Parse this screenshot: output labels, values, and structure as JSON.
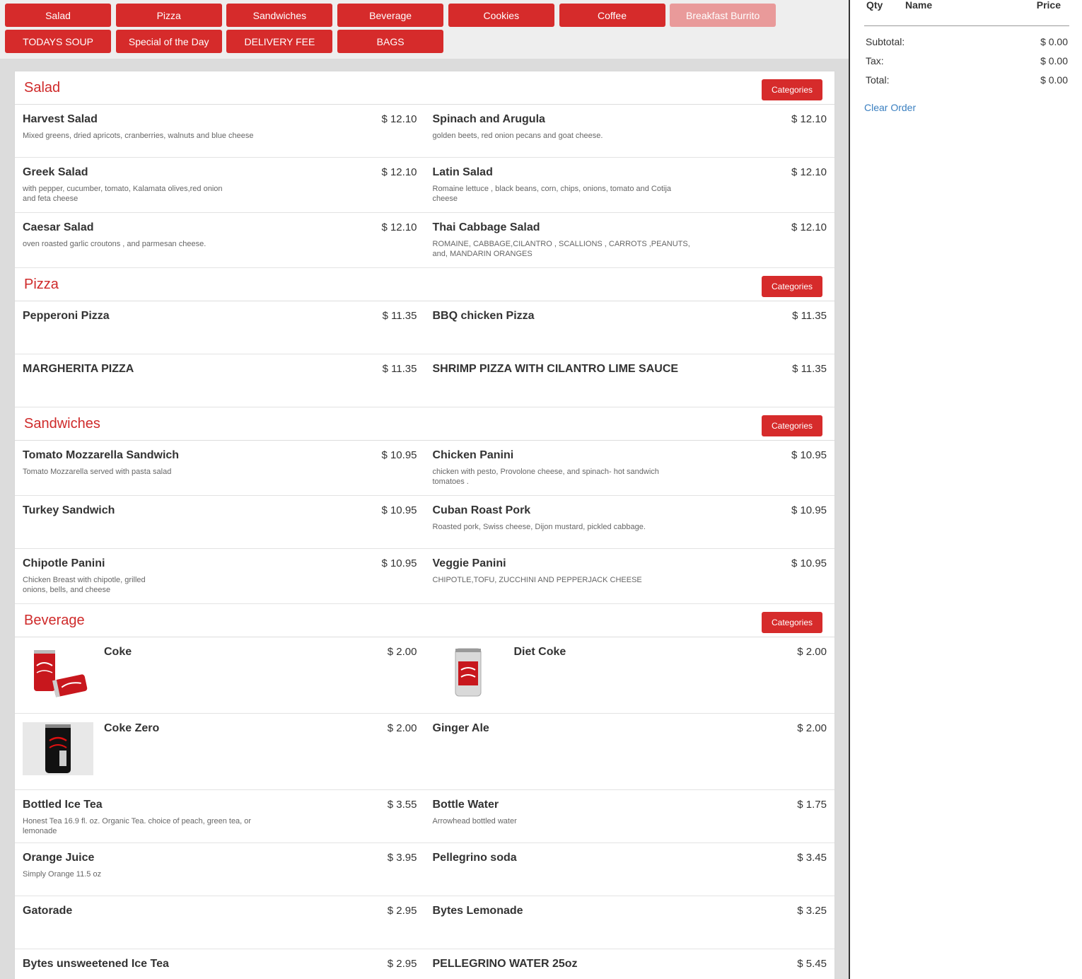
{
  "categories": [
    {
      "label": "Salad",
      "disabled": false
    },
    {
      "label": "Pizza",
      "disabled": false
    },
    {
      "label": "Sandwiches",
      "disabled": false
    },
    {
      "label": "Beverage",
      "disabled": false
    },
    {
      "label": "Cookies",
      "disabled": false
    },
    {
      "label": "Coffee",
      "disabled": false
    },
    {
      "label": "Breakfast Burrito",
      "disabled": true
    },
    {
      "label": "TODAYS SOUP",
      "disabled": false
    },
    {
      "label": "Special of the Day",
      "disabled": false
    },
    {
      "label": "DELIVERY FEE",
      "disabled": false
    },
    {
      "label": "BAGS",
      "disabled": false
    }
  ],
  "sections": [
    {
      "title": "Salad",
      "button": "Categories",
      "rows": [
        [
          {
            "name": "Harvest Salad",
            "price": "$ 12.10",
            "desc": "Mixed greens, dried apricots, cranberries, walnuts and blue cheese"
          },
          {
            "name": "Spinach and Arugula",
            "price": "$ 12.10",
            "desc": "golden beets, red onion pecans and goat cheese."
          }
        ],
        [
          {
            "name": "Greek Salad",
            "price": "$ 12.10",
            "desc": "with pepper, cucumber, tomato, Kalamata olives,red onion and feta cheese"
          },
          {
            "name": "Latin Salad",
            "price": "$ 12.10",
            "desc": "Romaine lettuce , black beans, corn, chips, onions, tomato and Cotija cheese"
          }
        ],
        [
          {
            "name": "Caesar Salad",
            "price": "$ 12.10",
            "desc": "oven roasted garlic croutons , and parmesan cheese."
          },
          {
            "name": "Thai Cabbage Salad",
            "price": "$ 12.10",
            "desc": "ROMAINE, CABBAGE,CILANTRO , SCALLIONS , CARROTS ,PEANUTS, and, MANDARIN ORANGES"
          }
        ]
      ]
    },
    {
      "title": "Pizza",
      "button": "Categories",
      "rows": [
        [
          {
            "name": "Pepperoni Pizza",
            "price": "$ 11.35",
            "desc": ""
          },
          {
            "name": "BBQ chicken Pizza",
            "price": "$ 11.35",
            "desc": ""
          }
        ],
        [
          {
            "name": "MARGHERITA PIZZA",
            "price": "$ 11.35",
            "desc": ""
          },
          {
            "name": "SHRIMP PIZZA WITH CILANTRO LIME SAUCE",
            "price": "$ 11.35",
            "desc": ""
          }
        ]
      ]
    },
    {
      "title": "Sandwiches",
      "button": "Categories",
      "rows": [
        [
          {
            "name": "Tomato Mozzarella Sandwich",
            "price": "$ 10.95",
            "desc": "Tomato Mozzarella served with pasta salad"
          },
          {
            "name": "Chicken Panini",
            "price": "$ 10.95",
            "desc": "chicken with pesto, Provolone cheese, and spinach- hot sandwich tomatoes ."
          }
        ],
        [
          {
            "name": "Turkey Sandwich",
            "price": "$ 10.95",
            "desc": ""
          },
          {
            "name": "Cuban Roast Pork",
            "price": "$ 10.95",
            "desc": "Roasted pork, Swiss cheese, Dijon mustard, pickled cabbage."
          }
        ],
        [
          {
            "name": "Chipotle Panini",
            "price": "$ 10.95",
            "desc": "Chicken Breast with chipotle, grilled onions, bells, and cheese"
          },
          {
            "name": "Veggie Panini",
            "price": "$ 10.95",
            "desc": "CHIPOTLE,TOFU, ZUCCHINI AND PEPPERJACK CHEESE"
          }
        ]
      ]
    },
    {
      "title": "Beverage",
      "button": "Categories",
      "rows": [
        [
          {
            "name": "Coke",
            "price": "$ 2.00",
            "desc": "",
            "img": "coke-can-image"
          },
          {
            "name": "Diet Coke",
            "price": "$ 2.00",
            "desc": "",
            "img": "diet-coke-can-image"
          }
        ],
        [
          {
            "name": "Coke Zero",
            "price": "$ 2.00",
            "desc": "",
            "img": "coke-zero-can-image"
          },
          {
            "name": "Ginger Ale",
            "price": "$ 2.00",
            "desc": ""
          }
        ],
        [
          {
            "name": "Bottled Ice Tea",
            "price": "$ 3.55",
            "desc": "Honest Tea 16.9 fl. oz. Organic Tea. choice of peach, green tea, or lemonade"
          },
          {
            "name": "Bottle Water",
            "price": "$ 1.75",
            "desc": "Arrowhead bottled water"
          }
        ],
        [
          {
            "name": "Orange Juice",
            "price": "$ 3.95",
            "desc": "Simply Orange 11.5 oz"
          },
          {
            "name": "Pellegrino soda",
            "price": "$ 3.45",
            "desc": ""
          }
        ],
        [
          {
            "name": "Gatorade",
            "price": "$ 2.95",
            "desc": ""
          },
          {
            "name": "Bytes Lemonade",
            "price": "$ 3.25",
            "desc": ""
          }
        ],
        [
          {
            "name": "Bytes unsweetened Ice Tea",
            "price": "$ 2.95",
            "desc": ""
          },
          {
            "name": "PELLEGRINO WATER 25oz",
            "price": "$ 5.45",
            "desc": ""
          }
        ]
      ]
    }
  ],
  "order": {
    "col_qty": "Qty",
    "col_name": "Name",
    "col_price": "Price",
    "subtotal_label": "Subtotal:",
    "subtotal_value": "$ 0.00",
    "tax_label": "Tax:",
    "tax_value": "$ 0.00",
    "total_label": "Total:",
    "total_value": "$ 0.00",
    "clear_label": "Clear Order"
  },
  "colors": {
    "accent": "#d62b2b",
    "accent_disabled": "#e99a9a",
    "link": "#3a7fc0"
  }
}
